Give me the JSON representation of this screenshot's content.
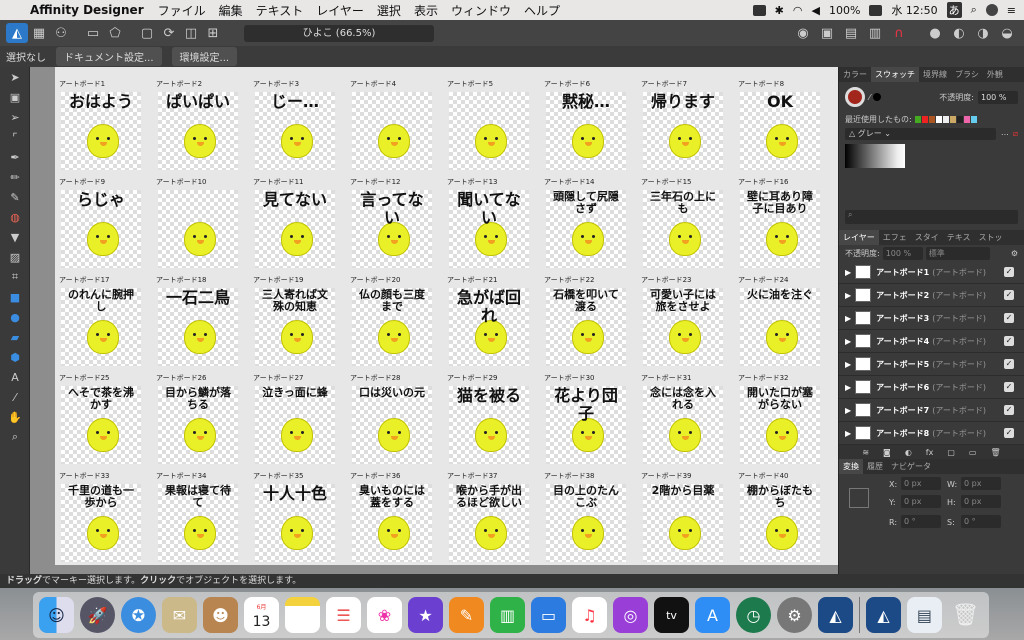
{
  "menubar": {
    "app": "Affinity Designer",
    "items": [
      "ファイル",
      "編集",
      "テキスト",
      "レイヤー",
      "選択",
      "表示",
      "ウィンドウ",
      "ヘルプ"
    ],
    "battery": "100%",
    "time": "水 12:50",
    "ime": "あ"
  },
  "toolbar": {
    "doc_title": "ひよこ (66.5%)"
  },
  "context": {
    "selection": "選択なし",
    "doc_setup": "ドキュメント設定...",
    "prefs": "環境設定..."
  },
  "artboards": [
    {
      "name": "アートボード1",
      "caption": "おはよう"
    },
    {
      "name": "アートボード2",
      "caption": "ぱいぱい"
    },
    {
      "name": "アートボード3",
      "caption": "じー…"
    },
    {
      "name": "アートボード4",
      "caption": ""
    },
    {
      "name": "アートボード5",
      "caption": ""
    },
    {
      "name": "アートボード6",
      "caption": "黙秘…"
    },
    {
      "name": "アートボード7",
      "caption": "帰ります"
    },
    {
      "name": "アートボード8",
      "caption": "OK"
    },
    {
      "name": "アートボード9",
      "caption": "らじゃ"
    },
    {
      "name": "アートボード10",
      "caption": ""
    },
    {
      "name": "アートボード11",
      "caption": "見てない"
    },
    {
      "name": "アートボード12",
      "caption": "言ってない"
    },
    {
      "name": "アートボード13",
      "caption": "聞いてない"
    },
    {
      "name": "アートボード14",
      "caption": "頭隠して尻隠さず"
    },
    {
      "name": "アートボード15",
      "caption": "三年石の上にも"
    },
    {
      "name": "アートボード16",
      "caption": "壁に耳あり障子に目あり"
    },
    {
      "name": "アートボード17",
      "caption": "のれんに腕押し"
    },
    {
      "name": "アートボード18",
      "caption": "一石二鳥"
    },
    {
      "name": "アートボード19",
      "caption": "三人寄れば文殊の知恵"
    },
    {
      "name": "アートボード20",
      "caption": "仏の顔も三度まで"
    },
    {
      "name": "アートボード21",
      "caption": "急がば回れ"
    },
    {
      "name": "アートボード22",
      "caption": "石橋を叩いて渡る"
    },
    {
      "name": "アートボード23",
      "caption": "可愛い子には旅をさせよ"
    },
    {
      "name": "アートボード24",
      "caption": "火に油を注ぐ"
    },
    {
      "name": "アートボード25",
      "caption": "へそで茶を沸かす"
    },
    {
      "name": "アートボード26",
      "caption": "目から鱗が落ちる"
    },
    {
      "name": "アートボード27",
      "caption": "泣きっ面に蜂"
    },
    {
      "name": "アートボード28",
      "caption": "口は災いの元"
    },
    {
      "name": "アートボード29",
      "caption": "猫を被る"
    },
    {
      "name": "アートボード30",
      "caption": "花より団子"
    },
    {
      "name": "アートボード31",
      "caption": "念には念を入れる"
    },
    {
      "name": "アートボード32",
      "caption": "開いた口が塞がらない"
    },
    {
      "name": "アートボード33",
      "caption": "千里の道も一歩から"
    },
    {
      "name": "アートボード34",
      "caption": "果報は寝て待て"
    },
    {
      "name": "アートボード35",
      "caption": "十人十色"
    },
    {
      "name": "アートボード36",
      "caption": "臭いものには蓋をする"
    },
    {
      "name": "アートボード37",
      "caption": "喉から手が出るほど欲しい"
    },
    {
      "name": "アートボード38",
      "caption": "目の上のたんこぶ"
    },
    {
      "name": "アートボード39",
      "caption": "2階から目薬"
    },
    {
      "name": "アートボード40",
      "caption": "棚からぼたもち"
    }
  ],
  "panel": {
    "top_tabs": [
      "カラー",
      "スウォッチ",
      "境界線",
      "ブラシ",
      "外観"
    ],
    "opacity_label": "不透明度:",
    "opacity": "100 %",
    "recent_label": "最近使用したもの:",
    "palette": "グレー",
    "layer_tabs": [
      "レイヤー",
      "エフェ",
      "スタイ",
      "テキス",
      "ストッ"
    ],
    "layer_opacity_label": "不透明度:",
    "layer_opacity": "100 %",
    "blend": "標準",
    "layers": [
      {
        "name": "アートボード1",
        "tag": "(アートボード)"
      },
      {
        "name": "アートボード2",
        "tag": "(アートボード)"
      },
      {
        "name": "アートボード3",
        "tag": "(アートボード)"
      },
      {
        "name": "アートボード4",
        "tag": "(アートボード)"
      },
      {
        "name": "アートボード5",
        "tag": "(アートボード)"
      },
      {
        "name": "アートボード6",
        "tag": "(アートボード)"
      },
      {
        "name": "アートボード7",
        "tag": "(アートボード)"
      },
      {
        "name": "アートボード8",
        "tag": "(アートボード)"
      }
    ],
    "bottom_tabs": [
      "変換",
      "履歴",
      "ナビゲータ"
    ],
    "transform": {
      "x_label": "X:",
      "x": "0 px",
      "w_label": "W:",
      "w": "0 px",
      "y_label": "Y:",
      "y": "0 px",
      "h_label": "H:",
      "h": "0 px",
      "r_label": "R:",
      "r": "0 °",
      "s_label": "S:",
      "s": "0 °"
    }
  },
  "status": {
    "drag": "ドラッグ",
    "t1": "でマーキー選択します。",
    "click": "クリック",
    "t2": "でオブジェクトを選択します。"
  },
  "dock": {
    "calendar_month": "6月",
    "calendar_day": "13",
    "tv": "tv"
  }
}
